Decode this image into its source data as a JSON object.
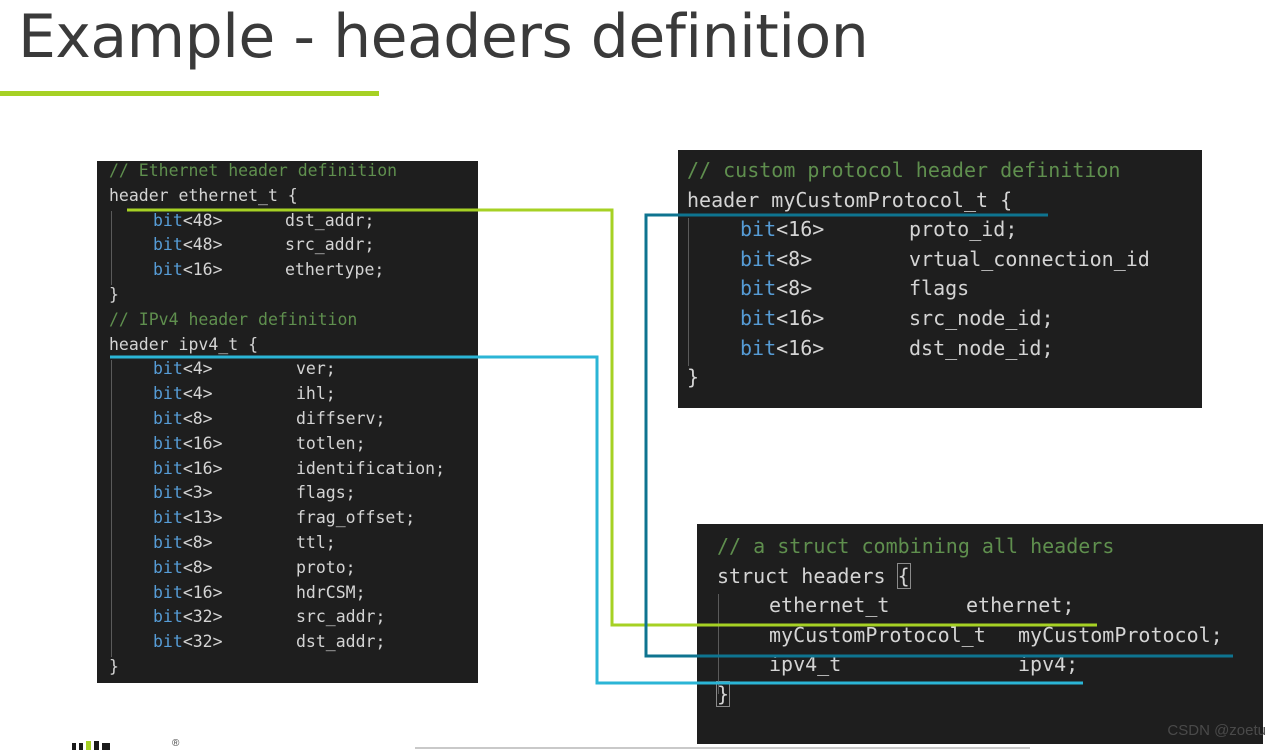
{
  "slide": {
    "title": "Example - headers definition",
    "watermark": "CSDN @zoetu",
    "registered_mark": "®"
  },
  "panels": {
    "ethernet_ipv4": {
      "lines": [
        {
          "comment": "// Ethernet header definition"
        },
        {
          "text": "header ethernet_t {"
        },
        {
          "kw": "bit",
          "type": "<48>",
          "name": "dst_addr;"
        },
        {
          "kw": "bit",
          "type": "<48>",
          "name": "src_addr;"
        },
        {
          "kw": "bit",
          "type": "<16>",
          "name": "ethertype;"
        },
        {
          "text": "}"
        },
        {
          "comment": "// IPv4 header definition"
        },
        {
          "text": "header ipv4_t {"
        },
        {
          "kw": "bit",
          "type": "<4>",
          "name": "ver;"
        },
        {
          "kw": "bit",
          "type": "<4>",
          "name": "ihl;"
        },
        {
          "kw": "bit",
          "type": "<8>",
          "name": "diffserv;"
        },
        {
          "kw": "bit",
          "type": "<16>",
          "name": "totlen;"
        },
        {
          "kw": "bit",
          "type": "<16>",
          "name": "identification;"
        },
        {
          "kw": "bit",
          "type": "<3>",
          "name": "flags;"
        },
        {
          "kw": "bit",
          "type": "<13>",
          "name": "frag_offset;"
        },
        {
          "kw": "bit",
          "type": "<8>",
          "name": "ttl;"
        },
        {
          "kw": "bit",
          "type": "<8>",
          "name": "proto;"
        },
        {
          "kw": "bit",
          "type": "<16>",
          "name": "hdrCSM;"
        },
        {
          "kw": "bit",
          "type": "<32>",
          "name": "src_addr;"
        },
        {
          "kw": "bit",
          "type": "<32>",
          "name": "dst_addr;"
        },
        {
          "text": "}"
        }
      ]
    },
    "custom": {
      "lines": [
        {
          "comment": "// custom protocol header definition"
        },
        {
          "text": "header myCustomProtocol_t {"
        },
        {
          "kw": "bit",
          "type": "<16>",
          "name": "proto_id;"
        },
        {
          "kw": "bit",
          "type": "<8>",
          "name": "vrtual_connection_id"
        },
        {
          "kw": "bit",
          "type": "<8>",
          "name": "flags"
        },
        {
          "kw": "bit",
          "type": "<16>",
          "name": "src_node_id;"
        },
        {
          "kw": "bit",
          "type": "<16>",
          "name": "dst_node_id;"
        },
        {
          "text": "}"
        }
      ]
    },
    "struct": {
      "lines": [
        {
          "comment": "// a struct combining all headers"
        },
        {
          "text": "struct headers {"
        },
        {
          "type_name": "ethernet_t",
          "field": "ethernet;"
        },
        {
          "type_name": "myCustomProtocol_t",
          "field": "myCustomProtocol;"
        },
        {
          "type_name": "ipv4_t",
          "field": "ipv4;"
        },
        {
          "text": "}"
        }
      ]
    }
  },
  "colors": {
    "accent_green": "#a6d124",
    "connector_teal": "#0e7490",
    "connector_cyan": "#2bb5d6",
    "panel_bg": "#1e1e1e",
    "comment": "#5f8f4e",
    "keyword": "#569cd6"
  }
}
